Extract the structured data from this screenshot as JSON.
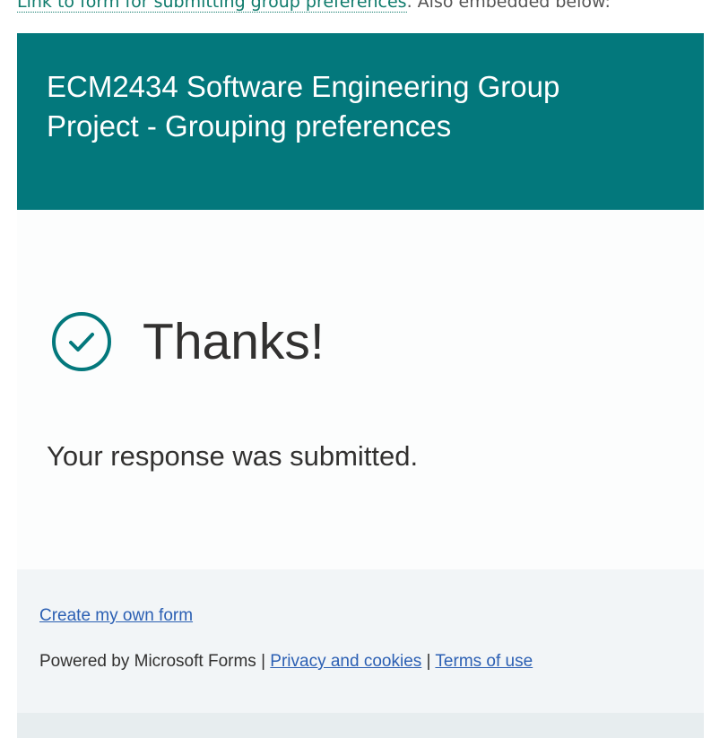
{
  "intro": {
    "link_text": "Link to form for submitting group preferences",
    "suffix_text": ". Also embedded below:"
  },
  "form": {
    "title": "ECM2434 Software Engineering Group Project - Grouping preferences",
    "thanks_heading": "Thanks!",
    "response_message": "Your response was submitted.",
    "check_icon": "check-circle-icon"
  },
  "footer": {
    "create_link": "Create my own form",
    "powered_by": "Powered by Microsoft Forms",
    "separator": "|",
    "privacy_link": "Privacy and cookies",
    "terms_link": "Terms of use"
  },
  "colors": {
    "header_bg": "#03787c",
    "accent": "#03787c",
    "link": "#2b5fb3",
    "footer_bg": "#f2f5f7"
  }
}
